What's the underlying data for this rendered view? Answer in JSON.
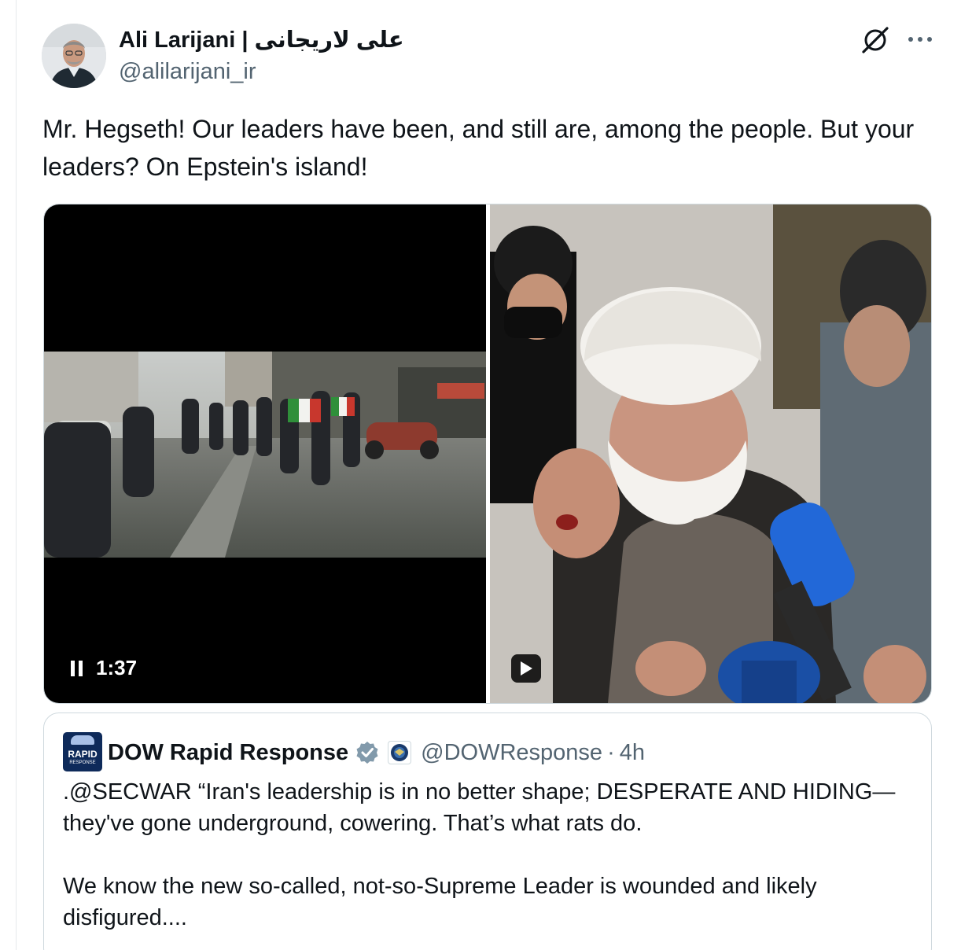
{
  "tweet": {
    "author": {
      "display_name": "Ali Larijani | علی لاریجانی",
      "handle": "@alilarijani_ir",
      "avatar_icon": "avatar-photo"
    },
    "actions": {
      "grok_icon": "grok-icon",
      "more_icon": "more-icon"
    },
    "text": "Mr. Hegseth! Our leaders have been, and still are, among the people. But your leaders? On Epstein's island!",
    "media": {
      "left": {
        "type": "video",
        "state": "playing",
        "duration": "1:37"
      },
      "right": {
        "type": "video",
        "state": "paused"
      }
    }
  },
  "quote": {
    "name": "DOW Rapid Response",
    "avatar_text": [
      "RAPID",
      "RESPONSE"
    ],
    "handle": "@DOWResponse",
    "separator": "·",
    "time": "4h",
    "verified_color": "#829aab",
    "text": ".@SECWAR “Iran's leadership is in no better shape; DESPERATE AND HIDING—they've gone underground, cowering. That’s what rats do.\n\nWe know the new so-called, not-so-Supreme Leader is wounded and likely disfigured...."
  }
}
